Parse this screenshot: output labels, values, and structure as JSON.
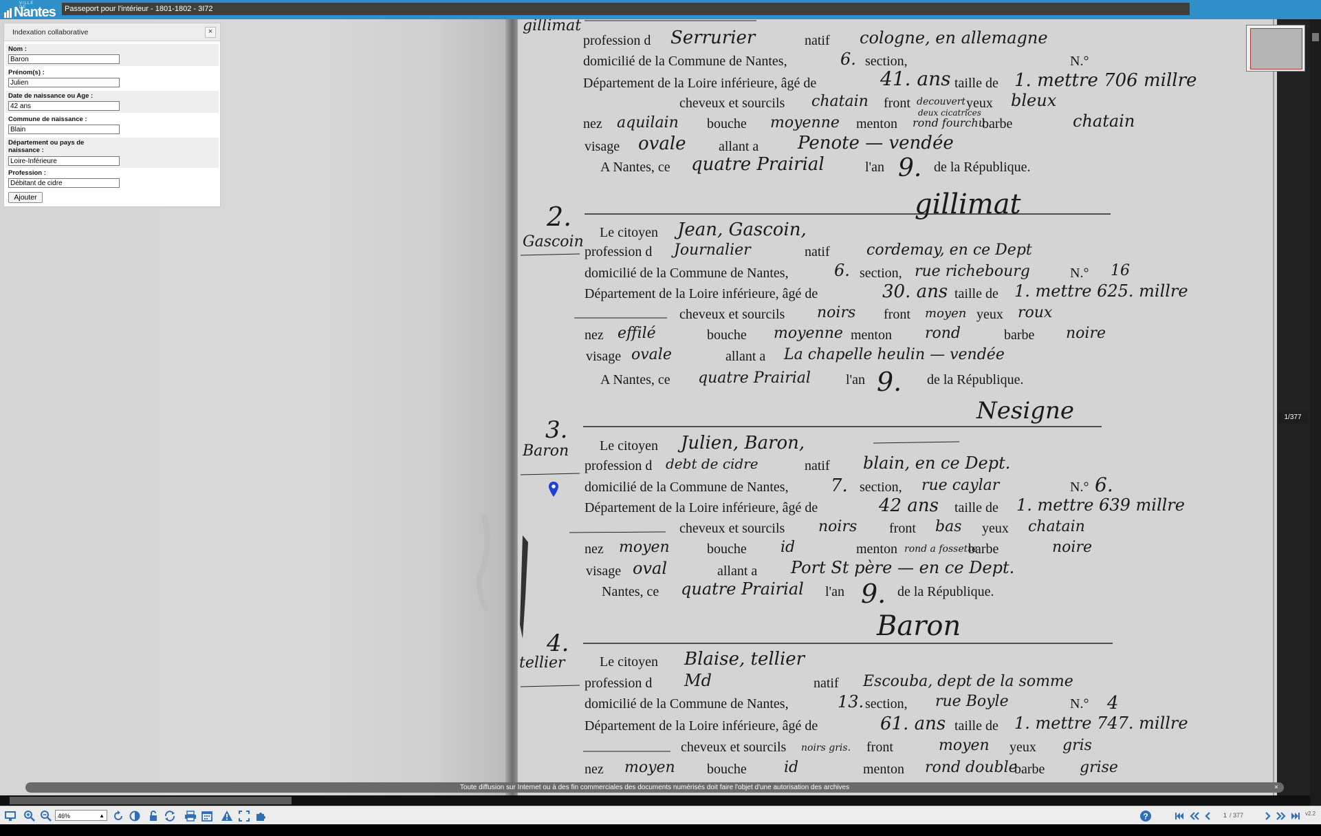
{
  "header": {
    "logo_small": "VILLE DE",
    "logo_name": "Nantes",
    "title": "Passeport pour l'intérieur - 1801-1802 - 3I72"
  },
  "panel": {
    "title": "Indexation collaborative",
    "close": "×",
    "fields": {
      "nom": {
        "label": "Nom :",
        "value": "Baron"
      },
      "prenom": {
        "label": "Prénom(s) :",
        "value": "Julien"
      },
      "age": {
        "label": "Date de naissance ou Age :",
        "value": "42 ans"
      },
      "commune": {
        "label": "Commune de naissance :",
        "value": "Blain"
      },
      "departement": {
        "label": "Département ou pays de naissance :",
        "value": "Loire-Inférieure"
      },
      "profession": {
        "label": "Profession :",
        "value": "Débitant de cidre"
      }
    },
    "add_button": "Ajouter"
  },
  "viewer": {
    "page_badge": "1/377",
    "notice": "Toute diffusion sur Internet ou à des fin commerciales des documents numérisés doit faire l'objet d'une autorisation des archives",
    "notice_close": "×"
  },
  "document": {
    "margin_names": [
      "gillimat",
      "Gascoin",
      "Baron",
      "tellier"
    ],
    "numbers": [
      "2.",
      "3.",
      "4."
    ],
    "printed": {
      "citoyen": "Le citoyen",
      "profession": "profession d",
      "natif": "natif",
      "domicilie": "domicilié de la Commune de Nantes,",
      "section": "section,",
      "no": "N.°",
      "departement": "Département de la Loire inférieure, âgé de",
      "taille": "taille de",
      "cheveux": "cheveux et sourcils",
      "front": "front",
      "yeux": "yeux",
      "nez": "nez",
      "bouche": "bouche",
      "menton": "menton",
      "barbe": "barbe",
      "visage": "visage",
      "allant": "allant a",
      "anantes": "A Nantes, ce",
      "an": "l'an",
      "republique": "de la République."
    },
    "entry1": {
      "profession": "Serrurier",
      "natif": "cologne, en allemagne",
      "section": "6.",
      "age": "41. ans",
      "taille": "1. mettre 706 millre",
      "cheveux": "chatain",
      "front": "decouvert",
      "yeux": "bleux",
      "nez": "aquilain",
      "bouche": "moyenne",
      "menton": "rond fourchu",
      "menton_extra": "deux cicatrices",
      "barbe": "chatain",
      "visage": "ovale",
      "allant": "Penote — vendée",
      "date": "quatre Prairial",
      "an": "9.",
      "signature": "gillimat"
    },
    "entry2": {
      "nom": "Jean, Gascoin,",
      "profession": "Journalier",
      "natif": "cordemay, en ce Dept",
      "section": "6.",
      "rue": "rue richebourg",
      "no": "16",
      "age": "30. ans",
      "taille": "1. mettre 625. millre",
      "cheveux": "noirs",
      "front": "moyen",
      "yeux": "roux",
      "nez": "effilé",
      "bouche": "moyenne",
      "menton": "rond",
      "barbe": "noire",
      "visage": "ovale",
      "allant": "La chapelle heulin — vendée",
      "date": "quatre Prairial",
      "an": "9.",
      "signature": "Nesigne"
    },
    "entry3": {
      "nom": "Julien, Baron,",
      "profession": "debt de cidre",
      "natif": "blain, en ce Dept.",
      "section": "7.",
      "rue": "rue caylar",
      "no": "6.",
      "age": "42 ans",
      "taille": "1. mettre 639 millre",
      "cheveux": "noirs",
      "front": "bas",
      "yeux": "chatain",
      "nez": "moyen",
      "bouche": "id",
      "menton": "rond a fossette",
      "barbe": "noire",
      "visage": "oval",
      "allant": "Port St père — en ce Dept.",
      "nantes": "Nantes, ce",
      "date": "quatre Prairial",
      "an": "9.",
      "signature": "Baron"
    },
    "entry4": {
      "nom": "Blaise, tellier",
      "profession": "Md",
      "natif": "Escouba, dept de la somme",
      "section": "13.",
      "rue": "rue Boyle",
      "no": "4",
      "age": "61. ans",
      "taille": "1. mettre 747. millre",
      "cheveux": "noirs gris.",
      "front": "moyen",
      "yeux": "gris",
      "nez": "moyen",
      "bouche": "id",
      "menton": "rond double",
      "barbe": "grise"
    }
  },
  "toolbar": {
    "zoom": "46%",
    "page": "1",
    "total": "/ 377",
    "version": "v2.2"
  },
  "colors": {
    "header": "#2f8fc9",
    "title_bg": "#3f3f3f",
    "accent": "#2f6fb5"
  }
}
